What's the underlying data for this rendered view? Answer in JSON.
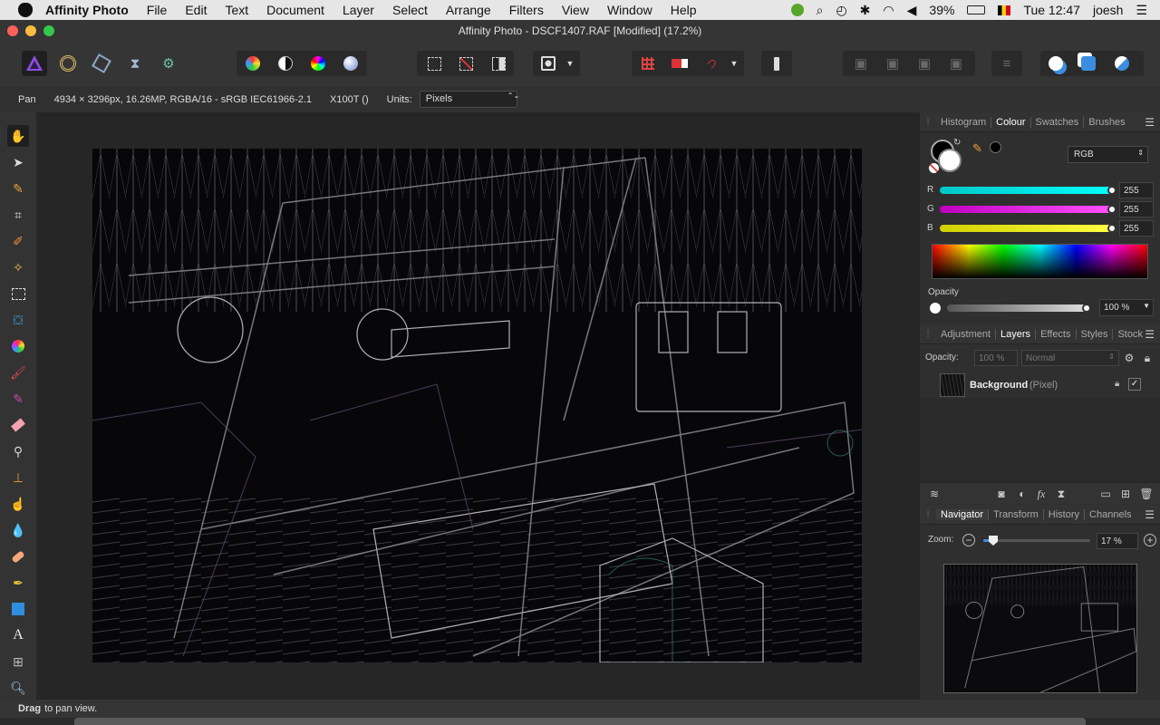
{
  "menubar": {
    "app": "Affinity Photo",
    "items": [
      "File",
      "Edit",
      "Text",
      "Document",
      "Layer",
      "Select",
      "Arrange",
      "Filters",
      "View",
      "Window",
      "Help"
    ],
    "battery": "39%",
    "clock": "Tue 12:47",
    "user": "joesh"
  },
  "window": {
    "title": "Affinity Photo - DSCF1407.RAF [Modified] (17.2%)"
  },
  "context": {
    "tool": "Pan",
    "doc_info": "4934 × 3296px, 16.26MP, RGBA/16 - sRGB IEC61966-2.1",
    "camera": "X100T ()",
    "units_label": "Units:",
    "units_value": "Pixels"
  },
  "colour_panel": {
    "tabs": [
      "Histogram",
      "Colour",
      "Swatches",
      "Brushes"
    ],
    "selected_tab": "Colour",
    "model": "RGB",
    "channels": [
      {
        "label": "R",
        "value": "255"
      },
      {
        "label": "G",
        "value": "255"
      },
      {
        "label": "B",
        "value": "255"
      }
    ],
    "opacity_label": "Opacity",
    "opacity_value": "100 %",
    "colors": {
      "r_track": "#00e5e5",
      "g_track": "#e020e0",
      "b_track": "#f0f000"
    }
  },
  "layers_panel": {
    "tabs": [
      "Adjustment",
      "Layers",
      "Effects",
      "Styles",
      "Stock"
    ],
    "selected_tab": "Layers",
    "opacity_label": "Opacity:",
    "opacity_value": "100 %",
    "blend_mode": "Normal",
    "layers": [
      {
        "name": "Background",
        "type": "(Pixel)"
      }
    ]
  },
  "navigator_panel": {
    "tabs": [
      "Navigator",
      "Transform",
      "History",
      "Channels"
    ],
    "selected_tab": "Navigator",
    "zoom_label": "Zoom:",
    "zoom_value": "17 %",
    "zoom_level": 0.17
  },
  "status": {
    "bold": "Drag",
    "text": "to pan view."
  },
  "accent": "#7d4fd1"
}
